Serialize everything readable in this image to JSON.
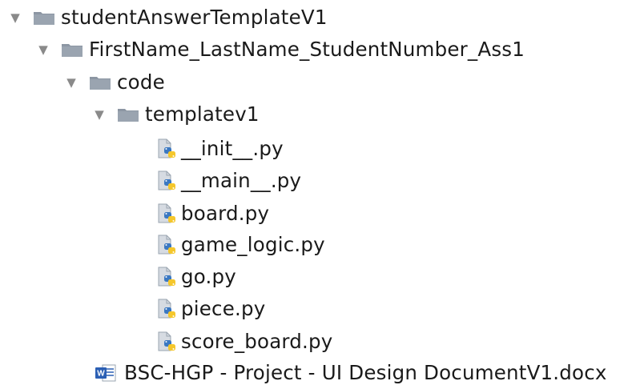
{
  "tree": {
    "root": {
      "label": "studentAnswerTemplateV1",
      "expanded": true
    },
    "submission_folder": {
      "label": "FirstName_LastName_StudentNumber_Ass1",
      "expanded": true
    },
    "code_folder": {
      "label": "code",
      "expanded": true
    },
    "template_folder": {
      "label": "templatev1",
      "expanded": true
    },
    "files": [
      {
        "label": "__init__.py",
        "icon": "python-file-icon"
      },
      {
        "label": "__main__.py",
        "icon": "python-file-icon"
      },
      {
        "label": "board.py",
        "icon": "python-file-icon"
      },
      {
        "label": "game_logic.py",
        "icon": "python-file-icon"
      },
      {
        "label": "go.py",
        "icon": "python-file-icon"
      },
      {
        "label": "piece.py",
        "icon": "python-file-icon"
      },
      {
        "label": "score_board.py",
        "icon": "python-file-icon"
      }
    ],
    "document": {
      "label": "BSC-HGP - Project - UI Design DocumentV1.docx",
      "icon": "word-document-icon"
    }
  },
  "colors": {
    "folder": "#8c96a3",
    "chevron": "#8a8a8a",
    "python_blue": "#3b78c2",
    "python_yellow": "#f5c72c",
    "word_blue": "#2b5fb4"
  }
}
